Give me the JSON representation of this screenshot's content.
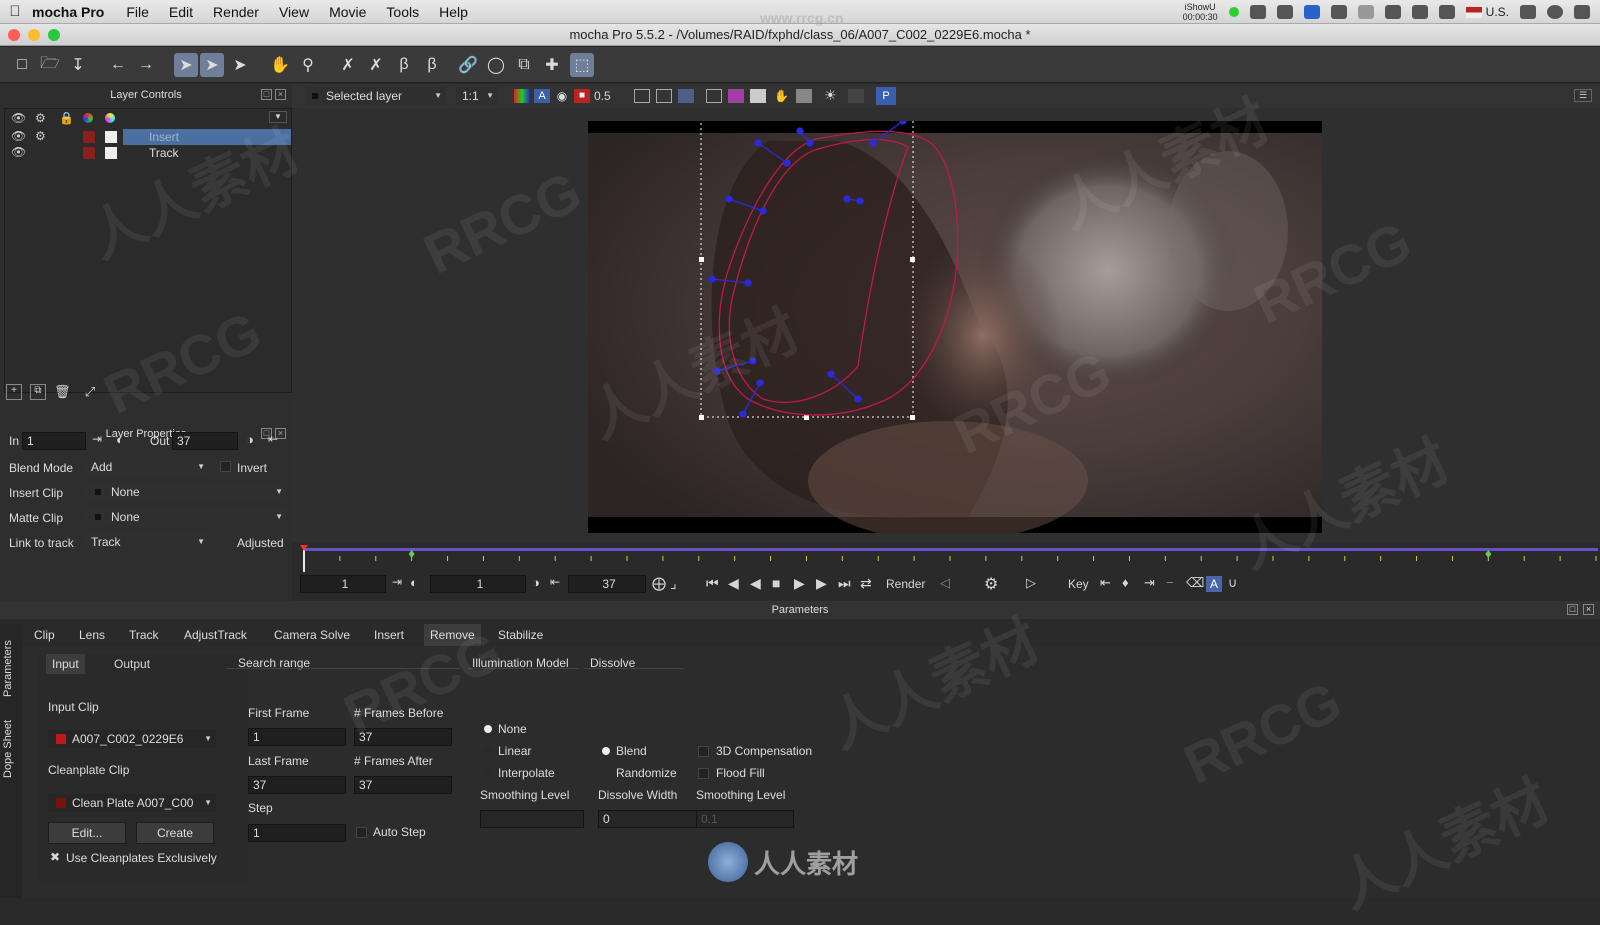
{
  "menubar": {
    "app": "mocha Pro",
    "items": [
      "File",
      "Edit",
      "Render",
      "View",
      "Movie",
      "Tools",
      "Help"
    ],
    "right": {
      "recorder": "iShowU",
      "recorder_time": "00:00:30",
      "locale": "U.S."
    }
  },
  "window": {
    "title": "mocha Pro 5.5.2 - /Volumes/RAID/fxphd/class_06/A007_C002_0229E6.mocha *"
  },
  "layer_controls": {
    "title": "Layer Controls",
    "layers": [
      {
        "name": "Insert",
        "selected": true,
        "visible": true
      },
      {
        "name": "Track",
        "selected": false,
        "visible": true
      }
    ]
  },
  "layer_properties": {
    "title": "Layer Properties",
    "in_label": "In",
    "in_value": "1",
    "out_label": "Out",
    "out_value": "37",
    "blend_mode_label": "Blend Mode",
    "blend_mode": "Add",
    "invert_label": "Invert",
    "insert_clip_label": "Insert Clip",
    "insert_clip": "None",
    "matte_clip_label": "Matte Clip",
    "matte_clip": "None",
    "link_label": "Link to track",
    "link_value": "Track",
    "adjusted_label": "Adjusted"
  },
  "viewer_controls": {
    "view_select": "Selected layer",
    "zoom": "1:1",
    "opacity": "0.5",
    "proxy_btn": "P"
  },
  "transport": {
    "start": "1",
    "current": "1",
    "end": "37",
    "render_label": "Render",
    "key_label": "Key"
  },
  "timeline": {
    "total_frames": 37,
    "current_frame": 1,
    "keyframes": [
      4,
      34
    ]
  },
  "parameters": {
    "title": "Parameters",
    "tabs": [
      "Clip",
      "Lens",
      "Track",
      "AdjustTrack",
      "Camera Solve",
      "Insert",
      "Remove",
      "Stabilize"
    ],
    "active_tab": "Remove",
    "side_tabs": [
      "Parameters",
      "Dope Sheet"
    ]
  },
  "remove": {
    "input_tab": "Input",
    "output_tab": "Output",
    "input_clip_label": "Input Clip",
    "input_clip": "A007_C002_0229E6",
    "cleanplate_label": "Cleanplate Clip",
    "cleanplate_clip": "Clean Plate  A007_C00",
    "edit_btn": "Edit...",
    "create_btn": "Create",
    "use_exclusive_label": "Use Cleanplates Exclusively",
    "search_range": "Search range",
    "first_frame_label": "First Frame",
    "first_frame": "1",
    "frames_before_label": "# Frames Before",
    "frames_before": "37",
    "last_frame_label": "Last Frame",
    "last_frame": "37",
    "frames_after_label": "# Frames After",
    "frames_after": "37",
    "step_label": "Step",
    "step": "1",
    "auto_step_label": "Auto Step",
    "illumination_title": "Illumination Model",
    "illumination_options": [
      "None",
      "Linear",
      "Interpolate"
    ],
    "illumination_selected": "None",
    "smoothing_label": "Smoothing Level",
    "smoothing_value": "",
    "dissolve_title": "Dissolve",
    "dissolve_options": [
      "Blend",
      "Randomize"
    ],
    "dissolve_selected": "Blend",
    "dissolve_width_label": "Dissolve Width",
    "dissolve_width": "0",
    "comp3d_label": "3D Compensation",
    "floodfill_label": "Flood Fill",
    "smoothing2_label": "Smoothing Level",
    "smoothing2_value": "0.1"
  },
  "watermarks": {
    "text1": "RRCG",
    "text2": "人人素材",
    "logo": "人人素材",
    "url": "www.rrcg.cn"
  },
  "colors": {
    "accent": "#6f7f9a",
    "spline": "#c2184b",
    "points": "#1e1edc",
    "selected_row": "#4c6fa1"
  }
}
